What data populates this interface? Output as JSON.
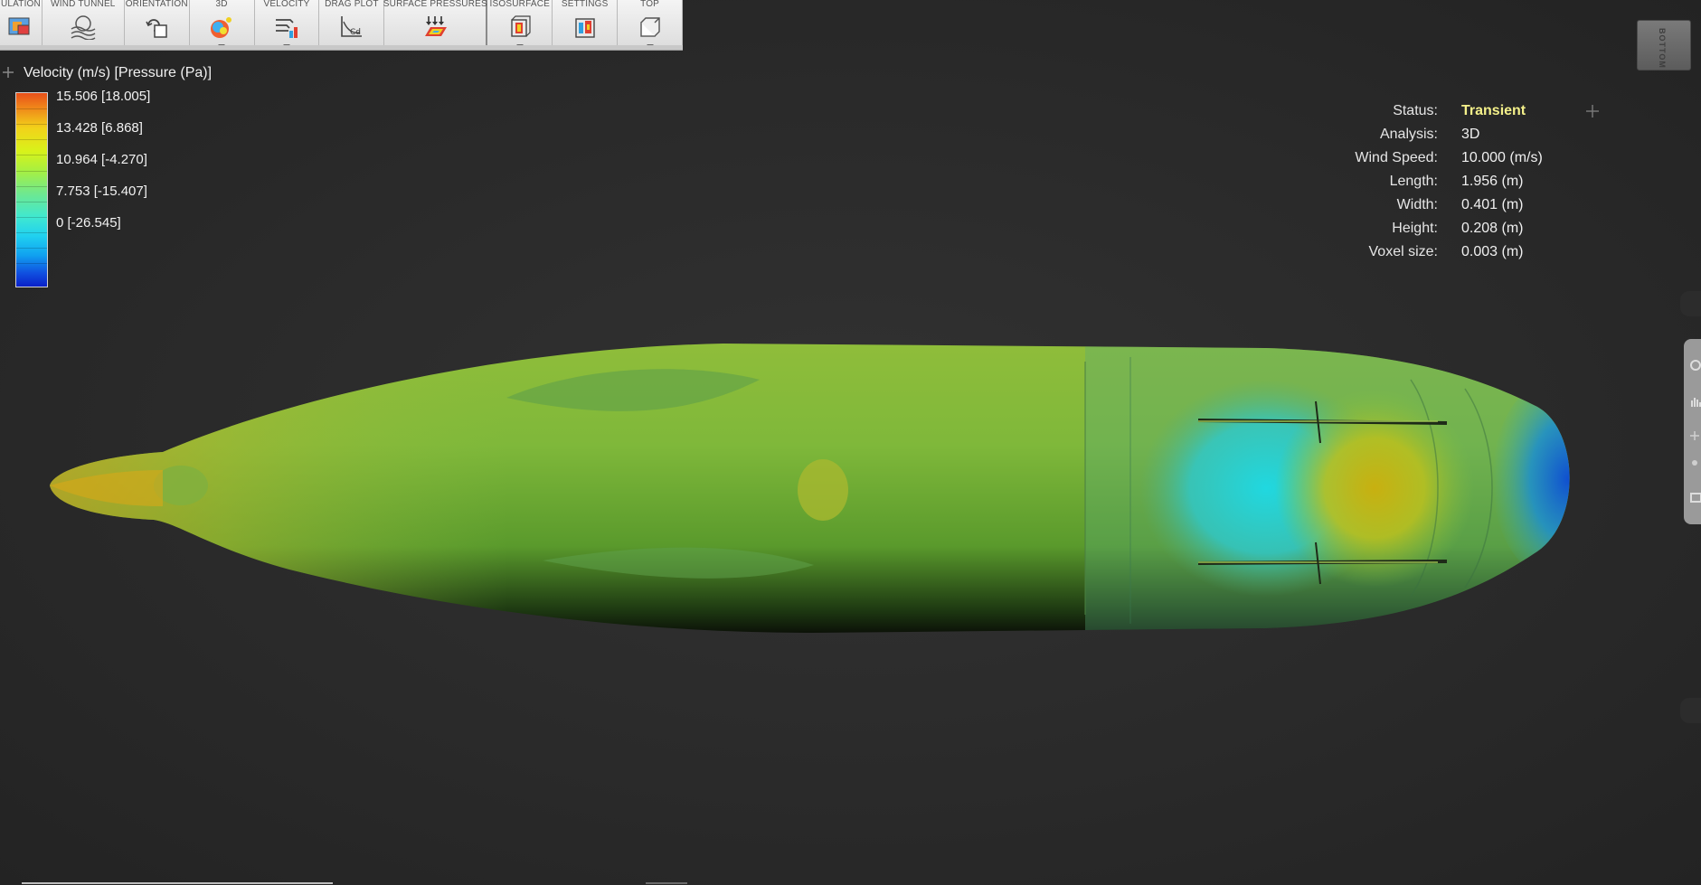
{
  "toolbar": {
    "items": [
      {
        "label": "ULATION",
        "icon": "simulation-icon",
        "caret": false
      },
      {
        "label": "WIND TUNNEL",
        "icon": "wind-tunnel-icon",
        "caret": false
      },
      {
        "label": "ORIENTATION",
        "icon": "orientation-icon",
        "caret": false
      },
      {
        "label": "3D",
        "icon": "3d-view-icon",
        "caret": true
      },
      {
        "label": "VELOCITY",
        "icon": "velocity-icon",
        "caret": true
      },
      {
        "label": "DRAG PLOT",
        "icon": "drag-plot-icon",
        "caret": false
      },
      {
        "label": "SURFACE PRESSURES",
        "icon": "surface-pressures-icon",
        "caret": false
      },
      {
        "label": "ISOSURFACE",
        "icon": "isosurface-icon",
        "caret": true
      },
      {
        "label": "SETTINGS",
        "icon": "settings-icon",
        "caret": false
      },
      {
        "label": "TOP",
        "icon": "top-view-icon",
        "caret": true
      }
    ]
  },
  "legend": {
    "title": "Velocity (m/s) [Pressure (Pa)]",
    "values": [
      "15.506 [18.005]",
      "13.428 [6.868]",
      "10.964 [-4.270]",
      "7.753 [-15.407]",
      "0 [-26.545]"
    ]
  },
  "status": {
    "rows": [
      {
        "key": "Status:",
        "value": "Transient"
      },
      {
        "key": "Analysis:",
        "value": "3D"
      },
      {
        "key": "Wind Speed:",
        "value": "10.000 (m/s)"
      },
      {
        "key": "Length:",
        "value": "1.956 (m)"
      },
      {
        "key": "Width:",
        "value": "0.401 (m)"
      },
      {
        "key": "Height:",
        "value": "0.208 (m)"
      },
      {
        "key": "Voxel size:",
        "value": "0.003 (m)"
      }
    ],
    "accent_color": "#f4f08a"
  },
  "viewcube": {
    "label": "BOTTOM"
  }
}
